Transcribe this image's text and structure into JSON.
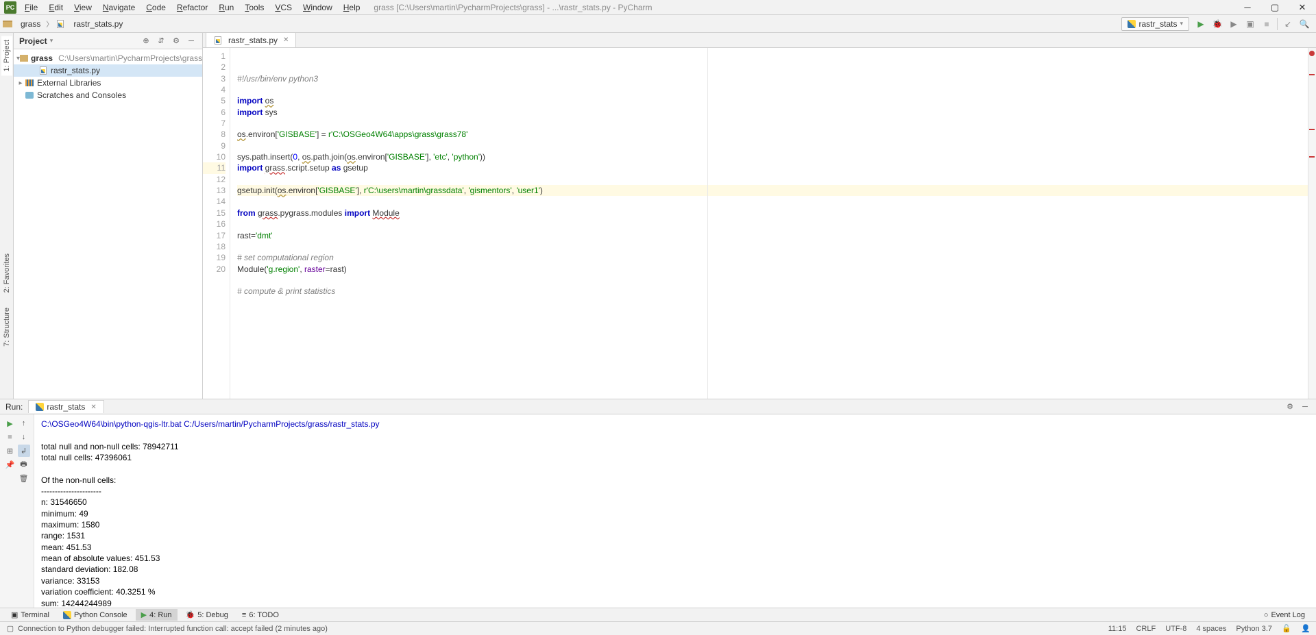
{
  "titlebar": {
    "menus": [
      "File",
      "Edit",
      "View",
      "Navigate",
      "Code",
      "Refactor",
      "Run",
      "Tools",
      "VCS",
      "Window",
      "Help"
    ],
    "title": "grass [C:\\Users\\martin\\PycharmProjects\\grass] - ...\\rastr_stats.py - PyCharm"
  },
  "navbar": {
    "breadcrumb": [
      "grass",
      "rastr_stats.py"
    ],
    "config": "rastr_stats"
  },
  "project_panel": {
    "title": "Project",
    "tree": {
      "root_name": "grass",
      "root_path": "C:\\Users\\martin\\PycharmProjects\\grass",
      "file": "rastr_stats.py",
      "ext_libs": "External Libraries",
      "scratches": "Scratches and Consoles"
    }
  },
  "side_tabs": {
    "project": "1: Project",
    "favorites": "2: Favorites",
    "structure": "7: Structure"
  },
  "editor": {
    "tab": "rastr_stats.py",
    "line_count": 20,
    "highlight_line": 11,
    "code": [
      {
        "l": 1,
        "parts": [
          {
            "c": "c-cmt",
            "t": "#!/usr/bin/env python3"
          }
        ]
      },
      {
        "l": 2,
        "parts": []
      },
      {
        "l": 3,
        "parts": [
          {
            "c": "c-kw",
            "t": "import "
          },
          {
            "c": "c-warn",
            "t": "os"
          }
        ]
      },
      {
        "l": 4,
        "parts": [
          {
            "c": "c-kw",
            "t": "import "
          },
          {
            "t": "sys"
          }
        ]
      },
      {
        "l": 5,
        "parts": []
      },
      {
        "l": 6,
        "parts": [
          {
            "c": "c-warn",
            "t": "os"
          },
          {
            "t": ".environ["
          },
          {
            "c": "c-str",
            "t": "'GISBASE'"
          },
          {
            "t": "] = "
          },
          {
            "c": "c-str",
            "t": "r'C:\\OSGeo4W64\\apps\\grass\\grass78'"
          }
        ]
      },
      {
        "l": 7,
        "parts": []
      },
      {
        "l": 8,
        "parts": [
          {
            "t": "sys.path.insert("
          },
          {
            "c": "c-num",
            "t": "0"
          },
          {
            "t": ", "
          },
          {
            "c": "c-warn",
            "t": "os"
          },
          {
            "t": ".path.join("
          },
          {
            "c": "c-warn",
            "t": "os"
          },
          {
            "t": ".environ["
          },
          {
            "c": "c-str",
            "t": "'GISBASE'"
          },
          {
            "t": "], "
          },
          {
            "c": "c-str",
            "t": "'etc'"
          },
          {
            "t": ", "
          },
          {
            "c": "c-str",
            "t": "'python'"
          },
          {
            "t": "))"
          }
        ]
      },
      {
        "l": 9,
        "parts": [
          {
            "c": "c-kw",
            "t": "import "
          },
          {
            "c": "c-err-u",
            "t": "grass"
          },
          {
            "t": ".script.setup "
          },
          {
            "c": "c-kw",
            "t": "as "
          },
          {
            "t": "gsetup"
          }
        ]
      },
      {
        "l": 10,
        "parts": []
      },
      {
        "l": 11,
        "parts": [
          {
            "t": "gsetup.init("
          },
          {
            "c": "c-warn",
            "t": "os"
          },
          {
            "t": ".environ["
          },
          {
            "c": "c-str",
            "t": "'GISBASE'"
          },
          {
            "t": "], "
          },
          {
            "c": "c-str",
            "t": "r'C:\\users\\martin\\grassdata'"
          },
          {
            "t": ", "
          },
          {
            "c": "c-str",
            "t": "'gismentors'"
          },
          {
            "t": ", "
          },
          {
            "c": "c-str",
            "t": "'user1'"
          },
          {
            "t": ")"
          }
        ]
      },
      {
        "l": 12,
        "parts": []
      },
      {
        "l": 13,
        "parts": [
          {
            "c": "c-kw",
            "t": "from "
          },
          {
            "c": "c-err-u",
            "t": "grass"
          },
          {
            "t": ".pygrass.modules "
          },
          {
            "c": "c-kw",
            "t": "import "
          },
          {
            "c": "c-err-u",
            "t": "Module"
          }
        ]
      },
      {
        "l": 14,
        "parts": []
      },
      {
        "l": 15,
        "parts": [
          {
            "t": "rast="
          },
          {
            "c": "c-str",
            "t": "'dmt'"
          }
        ]
      },
      {
        "l": 16,
        "parts": []
      },
      {
        "l": 17,
        "parts": [
          {
            "c": "c-cmt",
            "t": "# set computational region"
          }
        ]
      },
      {
        "l": 18,
        "parts": [
          {
            "t": "Module("
          },
          {
            "c": "c-str",
            "t": "'g.region'"
          },
          {
            "t": ", "
          },
          {
            "c": "c-param",
            "t": "raster"
          },
          {
            "t": "=rast)"
          }
        ]
      },
      {
        "l": 19,
        "parts": []
      },
      {
        "l": 20,
        "parts": [
          {
            "c": "c-cmt",
            "t": "# compute & print statistics"
          }
        ]
      }
    ]
  },
  "run": {
    "label": "Run:",
    "tab": "rastr_stats",
    "cmd": "C:\\OSGeo4W64\\bin\\python-qgis-ltr.bat C:/Users/martin/PycharmProjects/grass/rastr_stats.py",
    "output_lines": [
      "",
      "total null and non-null cells: 78942711",
      "total null cells: 47396061",
      "",
      "Of the non-null cells:",
      "----------------------",
      "n: 31546650",
      "minimum: 49",
      "maximum: 1580",
      "range: 1531",
      "mean: 451.53",
      "mean of absolute values: 451.53",
      "standard deviation: 182.08",
      "variance: 33153",
      "variation coefficient: 40.3251 %",
      "sum: 14244244989"
    ]
  },
  "bottom_windows": {
    "terminal": "Terminal",
    "python_console": "Python Console",
    "run": "4: Run",
    "debug": "5: Debug",
    "todo": "6: TODO",
    "event_log": "Event Log"
  },
  "status_bar": {
    "message": "Connection to Python debugger failed: Interrupted function call: accept failed (2 minutes ago)",
    "cursor": "11:15",
    "line_sep": "CRLF",
    "encoding": "UTF-8",
    "indent": "4 spaces",
    "python": "Python 3.7"
  }
}
